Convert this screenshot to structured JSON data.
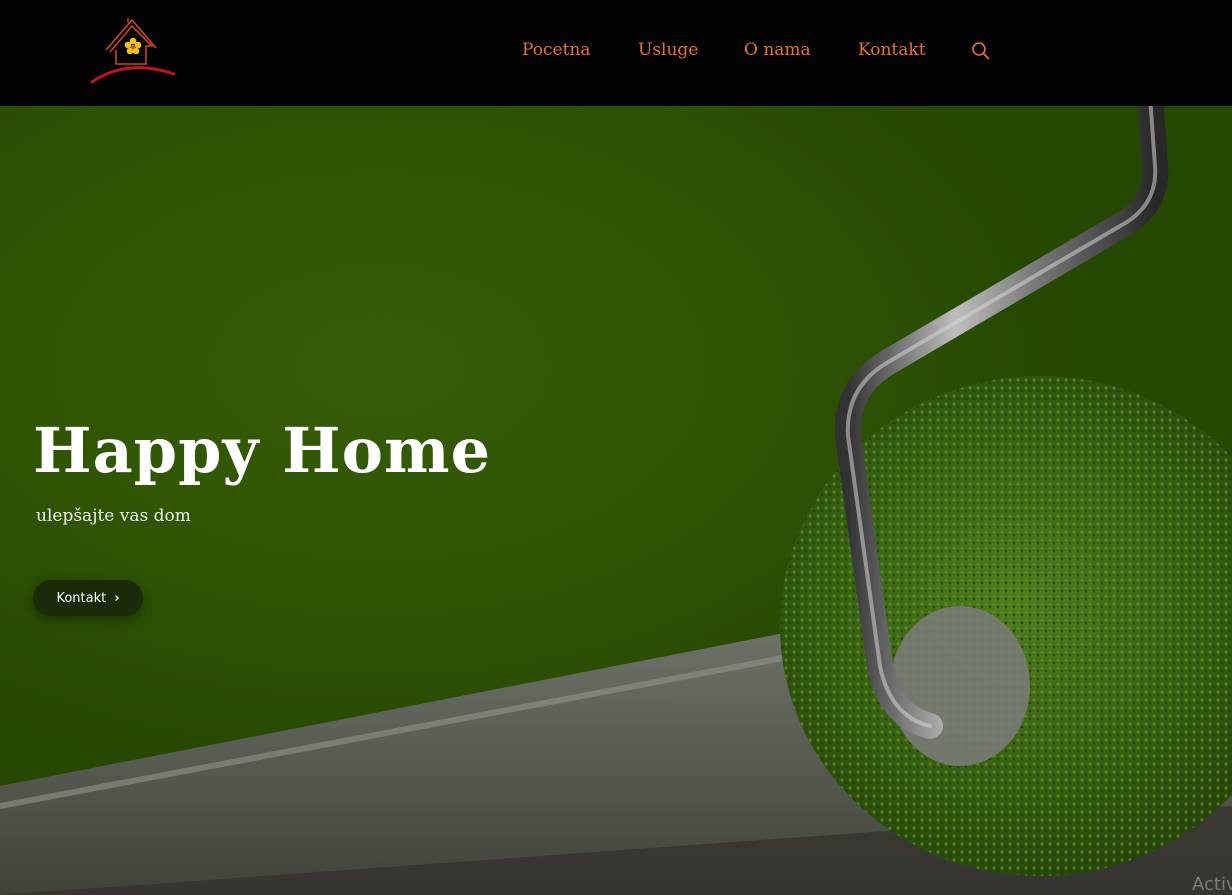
{
  "header": {
    "logo_alt": "Happy Home logo",
    "nav": [
      {
        "label": "Pocetna"
      },
      {
        "label": "Usluge"
      },
      {
        "label": "O nama"
      },
      {
        "label": "Kontakt"
      }
    ],
    "search_icon": "search-icon"
  },
  "hero": {
    "title": "Happy Home",
    "subtitle": "ulepšajte vas dom",
    "button_label": "Kontakt",
    "button_icon": "chevron-right-icon"
  },
  "watermark": "Activ",
  "colors": {
    "header_bg": "#030303",
    "nav_text": "#e5722a",
    "hero_green": "#356005",
    "button_bg": "#1b2a08"
  }
}
